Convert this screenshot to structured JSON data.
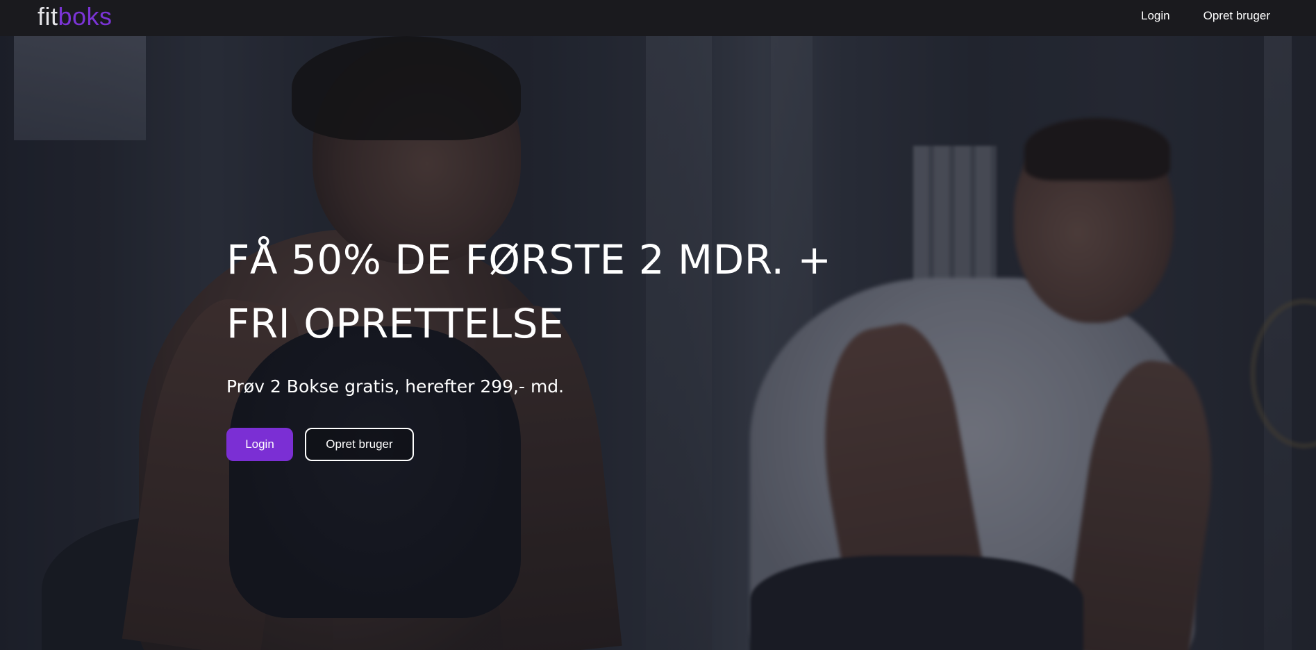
{
  "navbar": {
    "logo": {
      "part1": "fit",
      "part2": "boks"
    },
    "links": [
      {
        "label": "Login"
      },
      {
        "label": "Opret bruger"
      }
    ]
  },
  "hero": {
    "title_lines": [
      "FÅ 50% DE FØRSTE 2 MDR. +",
      "FRI OPRETTELSE"
    ],
    "subtitle": "Prøv 2 Bokse gratis, herefter 299,- md.",
    "buttons": {
      "primary": "Login",
      "secondary": "Opret bruger"
    },
    "background_description_icon": "gym-photo-image"
  },
  "colors": {
    "navbar_bg": "#1a1a1e",
    "accent": "#7b2fd4",
    "logo_primary": "#e6e6ea",
    "text": "#ffffff"
  }
}
